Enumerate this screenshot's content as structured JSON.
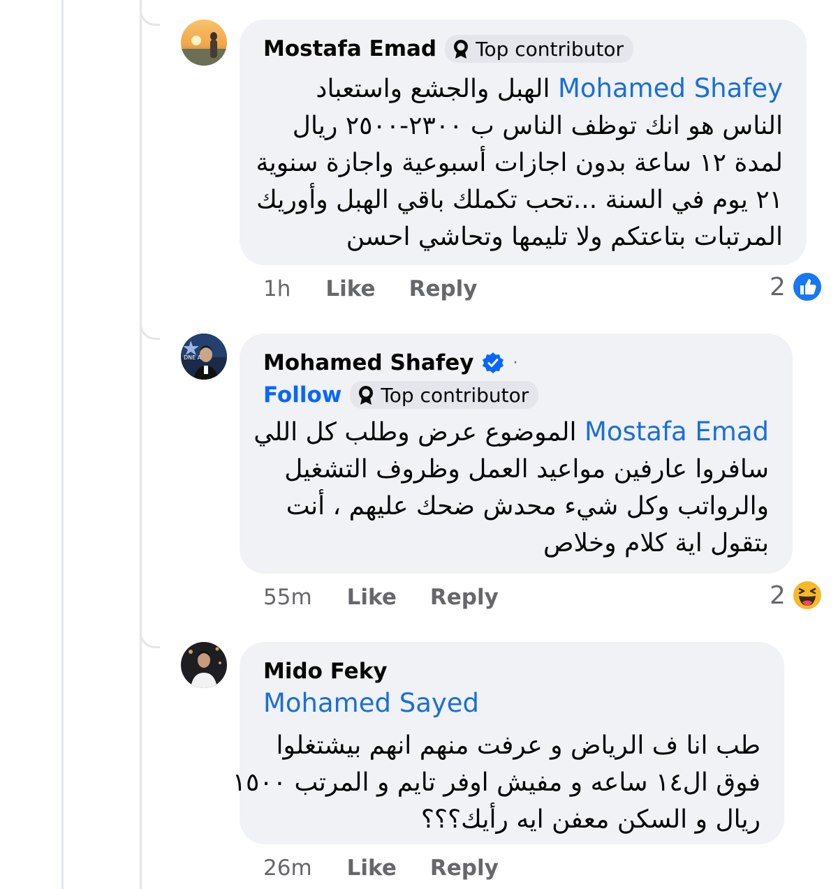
{
  "comments": [
    {
      "author": "Mostafa Emad",
      "badge": "Top contributor",
      "mention": "Mohamed Shafey",
      "first_line_rest": "الهبل والجشع واستعباد",
      "lines": [
        "الناس هو انك توظف الناس ب ٢٣٠٠-٢٥٠٠ ريال",
        "لمدة ١٢ ساعة بدون اجازات أسبوعية واجازة سنوية",
        "٢١ يوم في السنة ...تحب تكملك باقي الهبل وأوريك",
        "المرتبات بتاعتكم ولا تليمها وتحاشي احسن"
      ],
      "time": "1h",
      "like_label": "Like",
      "reply_label": "Reply",
      "reaction_count": "2",
      "reaction_icon": "like-icon"
    },
    {
      "author": "Mohamed Shafey",
      "verified_icon": "verified-badge-icon",
      "separator": "·",
      "follow_label": "Follow",
      "badge": "Top contributor",
      "mention": "Mostafa Emad",
      "first_line_rest": "الموضوع عرض وطلب كل اللي",
      "lines": [
        "سافروا عارفين مواعيد العمل وظروف التشغيل",
        "والرواتب وكل شيء محدش ضحك عليهم ، أنت",
        "بتقول اية كلام وخلاص"
      ],
      "time": "55m",
      "like_label": "Like",
      "reply_label": "Reply",
      "reaction_count": "2",
      "reaction_icon": "haha-icon"
    },
    {
      "author": "Mido Feky",
      "mention": "Mohamed Sayed",
      "lines": [
        "طب انا ف الرياض و عرفت منهم انهم بيشتغلوا",
        "فوق ال١٤ ساعه و مفيش اوفر تايم و المرتب ١٥٠٠",
        "ريال و السكن معفن ايه رأيك؟؟؟"
      ],
      "time": "26m",
      "like_label": "Like",
      "reply_label": "Reply"
    }
  ],
  "colors": {
    "bubble_bg": "#f0f2f5",
    "link_blue": "#1a6ed8",
    "meta_gray": "#65676b",
    "like_blue": "#1877f2"
  }
}
